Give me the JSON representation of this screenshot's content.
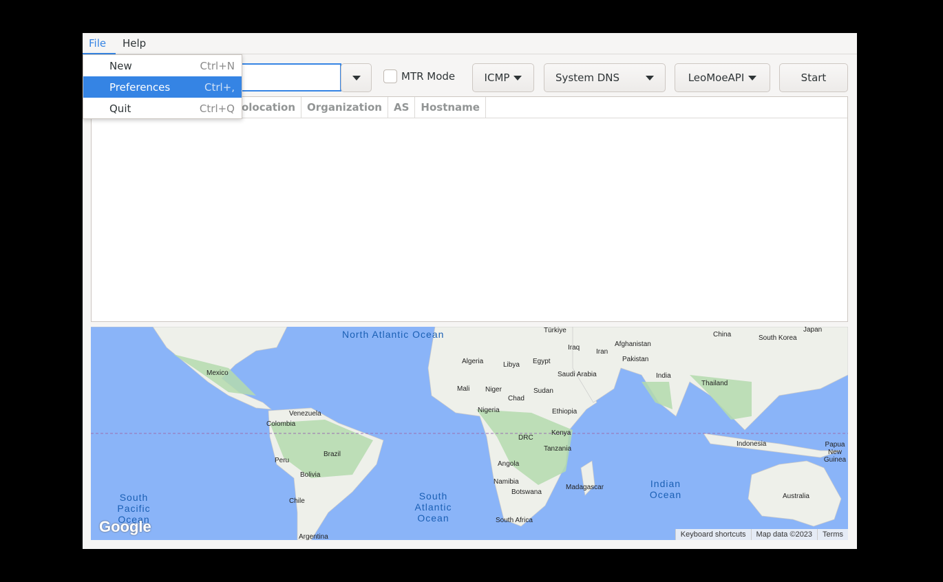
{
  "menubar": {
    "items": [
      {
        "label": "File"
      },
      {
        "label": "Help"
      }
    ]
  },
  "file_menu": {
    "items": [
      {
        "label": "New",
        "accel": "Ctrl+N"
      },
      {
        "label": "Preferences",
        "accel": "Ctrl+,",
        "selected": true
      },
      {
        "label": "Quit",
        "accel": "Ctrl+Q"
      }
    ]
  },
  "toolbar": {
    "target_value": "",
    "mtr_label": "MTR Mode",
    "mtr_checked": false,
    "protocol": "ICMP",
    "dns": "System DNS",
    "api": "LeoMoeAPI",
    "start": "Start"
  },
  "table": {
    "columns": [
      "Geolocation",
      "Organization",
      "AS",
      "Hostname"
    ],
    "visible_partial_first": "location",
    "rows": []
  },
  "map": {
    "oceans": [
      "North Atlantic Ocean",
      "South Atlantic Ocean",
      "South Pacific Ocean",
      "Indian Ocean"
    ],
    "labels": [
      "Mexico",
      "Venezuela",
      "Colombia",
      "Peru",
      "Brazil",
      "Bolivia",
      "Chile",
      "Argentina",
      "Algeria",
      "Libya",
      "Egypt",
      "Mali",
      "Niger",
      "Chad",
      "Sudan",
      "Nigeria",
      "Ethiopia",
      "DRC",
      "Kenya",
      "Tanzania",
      "Angola",
      "Namibia",
      "Botswana",
      "South Africa",
      "Madagascar",
      "Saudi Arabia",
      "Iraq",
      "Iran",
      "Türkiye",
      "Afghanistan",
      "Pakistan",
      "India",
      "China",
      "Thailand",
      "South Korea",
      "Japan",
      "Indonesia",
      "Papua New Guinea",
      "Australia"
    ],
    "logo": "Google",
    "attribution": [
      "Keyboard shortcuts",
      "Map data ©2023",
      "Terms"
    ],
    "colors": {
      "water": "#8ab4f8",
      "land": "#f1f3f4",
      "forest": "#a8d5a2"
    }
  }
}
